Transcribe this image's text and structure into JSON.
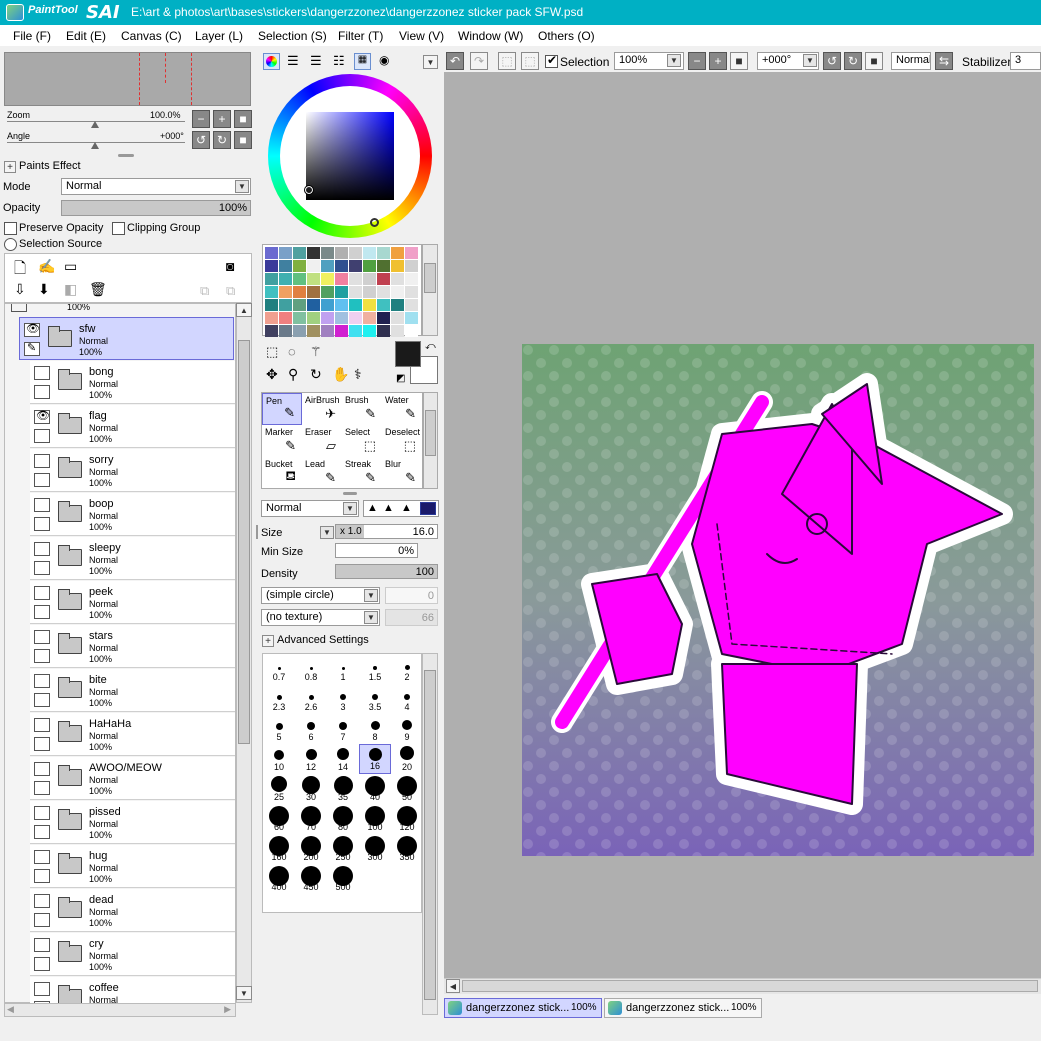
{
  "app": {
    "logo_small": "PaintTool",
    "logo_big": "SAI",
    "title": "E:\\art & photos\\art\\bases\\stickers\\dangerzzonez\\dangerzzonez sticker pack SFW.psd",
    "accent": "#00b0c4"
  },
  "menu": [
    "File (F)",
    "Edit (E)",
    "Canvas (C)",
    "Layer (L)",
    "Selection (S)",
    "Filter (T)",
    "View (V)",
    "Window (W)",
    "Others (O)"
  ],
  "navigator": {
    "zoom_label": "Zoom",
    "zoom_value": "100.0%",
    "angle_label": "Angle",
    "angle_value": "+000°"
  },
  "layer_props": {
    "paints_effect": "Paints Effect",
    "mode_label": "Mode",
    "mode_value": "Normal",
    "opacity_label": "Opacity",
    "opacity_value": "100%",
    "preserve_opacity": "Preserve Opacity",
    "clipping_group": "Clipping Group",
    "selection_source": "Selection Source"
  },
  "layers": {
    "top_partial_opacity": "100%",
    "items": [
      {
        "name": "sfw",
        "mode": "Normal",
        "opacity": "100%",
        "visible": true,
        "selected": true
      },
      {
        "name": "bong",
        "mode": "Normal",
        "opacity": "100%",
        "visible": false
      },
      {
        "name": "flag",
        "mode": "Normal",
        "opacity": "100%",
        "visible": true
      },
      {
        "name": "sorry",
        "mode": "Normal",
        "opacity": "100%",
        "visible": false
      },
      {
        "name": "boop",
        "mode": "Normal",
        "opacity": "100%",
        "visible": false
      },
      {
        "name": "sleepy",
        "mode": "Normal",
        "opacity": "100%",
        "visible": false
      },
      {
        "name": "peek",
        "mode": "Normal",
        "opacity": "100%",
        "visible": false
      },
      {
        "name": "stars",
        "mode": "Normal",
        "opacity": "100%",
        "visible": false
      },
      {
        "name": "bite",
        "mode": "Normal",
        "opacity": "100%",
        "visible": false
      },
      {
        "name": "HaHaHa",
        "mode": "Normal",
        "opacity": "100%",
        "visible": false
      },
      {
        "name": "AWOO/MEOW",
        "mode": "Normal",
        "opacity": "100%",
        "visible": false
      },
      {
        "name": "pissed",
        "mode": "Normal",
        "opacity": "100%",
        "visible": false
      },
      {
        "name": "hug",
        "mode": "Normal",
        "opacity": "100%",
        "visible": false
      },
      {
        "name": "dead",
        "mode": "Normal",
        "opacity": "100%",
        "visible": false
      },
      {
        "name": "cry",
        "mode": "Normal",
        "opacity": "100%",
        "visible": false
      },
      {
        "name": "coffee",
        "mode": "Normal",
        "opacity": "",
        "visible": false
      }
    ]
  },
  "tools": {
    "items": [
      {
        "name": "Pen",
        "icon": "✎",
        "selected": true
      },
      {
        "name": "AirBrush",
        "icon": "✈"
      },
      {
        "name": "Brush",
        "icon": "✎"
      },
      {
        "name": "Water",
        "icon": "✎"
      },
      {
        "name": "Marker",
        "icon": "✎"
      },
      {
        "name": "Eraser",
        "icon": "▱"
      },
      {
        "name": "Select",
        "icon": "⬚"
      },
      {
        "name": "Deselect",
        "icon": "⬚"
      },
      {
        "name": "Bucket",
        "icon": "⛾"
      },
      {
        "name": "Lead",
        "icon": "✎"
      },
      {
        "name": "Streak",
        "icon": "✎"
      },
      {
        "name": "Blur",
        "icon": "✎"
      }
    ]
  },
  "brush": {
    "blend_mode": "Normal",
    "size_label": "Size",
    "size_mult": "x 1.0",
    "size_value": "16.0",
    "min_size_label": "Min Size",
    "min_size_value": "0%",
    "density_label": "Density",
    "density_value": "100",
    "shape": "(simple circle)",
    "shape_value": "0",
    "texture": "(no texture)",
    "texture_value": "66",
    "advanced": "Advanced Settings",
    "sizes": [
      "0.7",
      "0.8",
      "1",
      "1.5",
      "2",
      "2.3",
      "2.6",
      "3",
      "3.5",
      "4",
      "5",
      "6",
      "7",
      "8",
      "9",
      "10",
      "12",
      "14",
      "16",
      "20",
      "25",
      "30",
      "35",
      "40",
      "50",
      "60",
      "70",
      "80",
      "100",
      "120",
      "160",
      "200",
      "250",
      "300",
      "350",
      "400",
      "450",
      "500"
    ],
    "selected_size": "16"
  },
  "canvas_toolbar": {
    "selection_label": "Selection",
    "zoom": "100%",
    "angle": "+000°",
    "blend": "Normal",
    "stabilizer_label": "Stabilizer",
    "stabilizer_value": "3"
  },
  "tabs": [
    {
      "label": "dangerzzonez stick...",
      "zoom": "100%",
      "active": true
    },
    {
      "label": "dangerzzonez stick...",
      "zoom": "100%",
      "active": false
    }
  ],
  "colors": {
    "primary": "#1a1a1a",
    "secondary": "#ffffff",
    "art_fill": "#ff00ff",
    "bg_top": "#6ea373",
    "bg_bottom": "#7a63b8"
  }
}
